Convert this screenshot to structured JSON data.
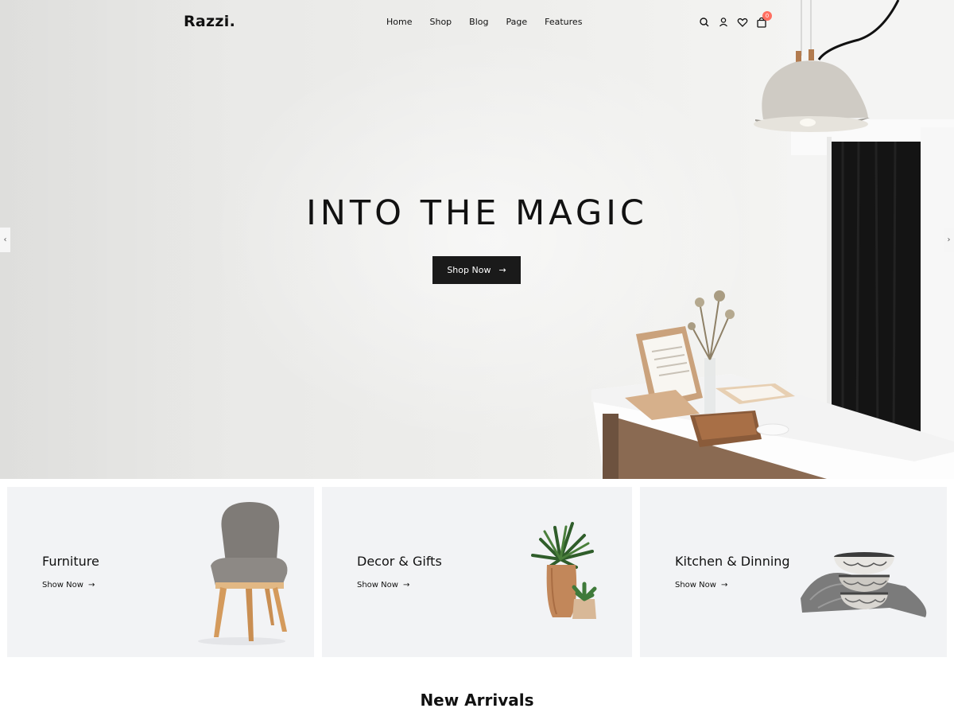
{
  "brand": {
    "logo": "Razzi."
  },
  "nav": {
    "items": [
      "Home",
      "Shop",
      "Blog",
      "Page",
      "Features"
    ]
  },
  "header_icons": {
    "search": "search-icon",
    "account": "user-icon",
    "wishlist": "heart-icon",
    "cart": "bag-icon",
    "cart_count": "0"
  },
  "hero": {
    "title": "INTO THE MAGIC",
    "button_label": "Shop Now",
    "button_arrow": "→",
    "prev_arrow": "‹",
    "next_arrow": "›"
  },
  "categories": [
    {
      "title": "Furniture",
      "link": "Show Now",
      "arrow": "→"
    },
    {
      "title": "Decor & Gifts",
      "link": "Show Now",
      "arrow": "→"
    },
    {
      "title": "Kitchen & Dinning",
      "link": "Show Now",
      "arrow": "→"
    }
  ],
  "sections": {
    "new_arrivals": "New Arrivals"
  },
  "colors": {
    "accent_badge": "#ff6f61",
    "button_bg": "#1a1a1a",
    "card_bg": "#f2f3f5"
  }
}
